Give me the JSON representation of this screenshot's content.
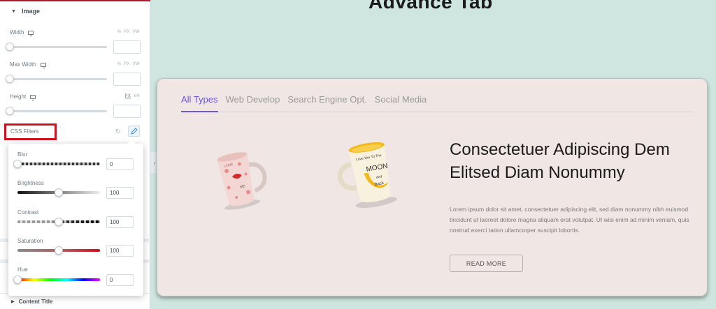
{
  "panel": {
    "section_title": "Image",
    "width": {
      "label": "Width",
      "units": [
        "PX",
        "VW"
      ]
    },
    "max_width": {
      "label": "Max Width",
      "units": [
        "PX",
        "VW"
      ]
    },
    "height": {
      "label": "Height",
      "units": [
        "PX",
        "VH"
      ]
    },
    "css_filters_label": "CSS Filters",
    "filters": {
      "blur": {
        "label": "Blur",
        "value": "0"
      },
      "brightness": {
        "label": "Brightness",
        "value": "100"
      },
      "contrast": {
        "label": "Contrast",
        "value": "100"
      },
      "saturation": {
        "label": "Saturation",
        "value": "100"
      },
      "hue": {
        "label": "Hue",
        "value": "0"
      }
    },
    "next_section": "Content Title"
  },
  "preview": {
    "page_heading": "Advance Tab",
    "tabs": [
      "All Types",
      "Web Develop",
      "Search Engine Opt.",
      "Social Media"
    ],
    "active_tab": "All Types",
    "title": "Consectetuer Adipiscing Dem Elitsed Diam Nonummy",
    "body": "Lorem ipsum dolor sit amet, consectetuer adipiscing elit, sed diam nonummy nibh euismod tincidunt ut laoreet dolore magna aliquam erat volutpat. Ut wisi enim ad minim veniam, quis nostrud exerci tation ullamcorper suscipit lobortis.",
    "button": "READ MORE",
    "mug1_text": [
      "LOVE",
      "ME"
    ],
    "mug2_text": [
      "Love You To The",
      "MOON",
      "and",
      "Back"
    ]
  },
  "colors": {
    "accent": "#6b56e8",
    "highlight_border": "#d0111f",
    "background": "#cfe5df",
    "card": "#f0e6e4"
  }
}
